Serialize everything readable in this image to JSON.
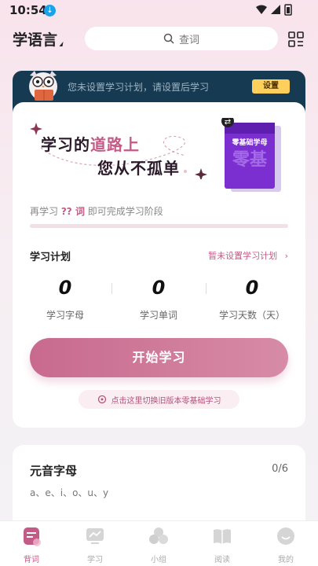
{
  "status_bar": {
    "time": "10:54"
  },
  "header": {
    "app_title": "学语言",
    "search_placeholder": "查词"
  },
  "plan_banner": {
    "text": "您未设置学习计划，请设置后学习",
    "button": "设置"
  },
  "hero": {
    "line1_before": "学习的",
    "line1_highlight": "道路上",
    "line2": "您从不孤单",
    "book_label": "零基础学母"
  },
  "progress": {
    "prefix": "再学习",
    "count": "?? 词",
    "suffix": "即可完成学习阶段",
    "fraction": 0
  },
  "study_plan": {
    "title": "学习计划",
    "link": "暂未设置学习计划",
    "stats": [
      {
        "value": "0",
        "label": "学习字母"
      },
      {
        "value": "0",
        "label": "学习单词"
      },
      {
        "value": "0",
        "label": "学习天数（天）"
      }
    ]
  },
  "start_button": "开始学习",
  "switch_link": "点击这里切换旧版本零基础学习",
  "vowels": {
    "title": "元音字母",
    "count": "0/6",
    "letters": "a、e、i、o、u、y"
  },
  "bottom_nav": [
    {
      "label": "背词",
      "icon": "book-icon",
      "active": true
    },
    {
      "label": "学习",
      "icon": "chart-icon",
      "active": false
    },
    {
      "label": "小组",
      "icon": "group-icon",
      "active": false
    },
    {
      "label": "阅读",
      "icon": "reading-icon",
      "active": false
    },
    {
      "label": "我的",
      "icon": "profile-icon",
      "active": false
    }
  ],
  "colors": {
    "accent": "#c45a86",
    "banner_bg": "#153a52",
    "set_button": "#ffcf5c"
  }
}
